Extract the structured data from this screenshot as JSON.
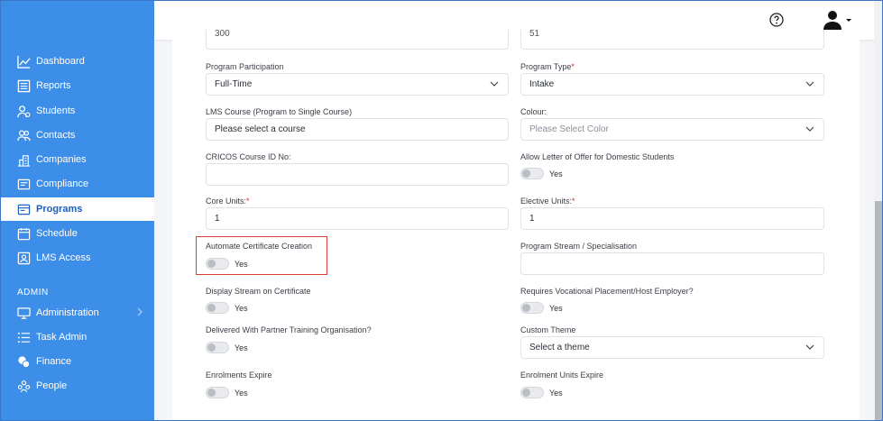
{
  "sidebar": {
    "items": [
      {
        "label": "Dashboard",
        "icon": "chart-line-icon"
      },
      {
        "label": "Reports",
        "icon": "report-icon"
      },
      {
        "label": "Students",
        "icon": "students-icon"
      },
      {
        "label": "Contacts",
        "icon": "contacts-icon"
      },
      {
        "label": "Companies",
        "icon": "companies-icon"
      },
      {
        "label": "Compliance",
        "icon": "compliance-icon"
      },
      {
        "label": "Programs",
        "icon": "programs-icon",
        "active": true
      },
      {
        "label": "Schedule",
        "icon": "calendar-icon"
      },
      {
        "label": "LMS Access",
        "icon": "lms-icon"
      }
    ],
    "admin_section": "ADMIN",
    "admin_items": [
      {
        "label": "Administration",
        "icon": "monitor-icon",
        "has_children": true
      },
      {
        "label": "Task Admin",
        "icon": "list-icon"
      },
      {
        "label": "Finance",
        "icon": "coins-icon"
      },
      {
        "label": "People",
        "icon": "people-icon"
      }
    ]
  },
  "header": {
    "help_icon": "help-circle-icon",
    "user_icon": "user-avatar-icon"
  },
  "form": {
    "top_left_partial": "300",
    "top_right_partial": "51",
    "program_participation": {
      "label": "Program Participation",
      "value": "Full-Time"
    },
    "program_type": {
      "label": "Program Type",
      "required": "*",
      "value": "Intake"
    },
    "lms_course": {
      "label": "LMS Course (Program to Single Course)",
      "value": "Please select a course"
    },
    "colour": {
      "label": "Colour:",
      "placeholder": "Please Select Color"
    },
    "cricos": {
      "label": "CRICOS Course ID No:",
      "value": ""
    },
    "allow_letter": {
      "label": "Allow Letter of Offer for Domestic Students",
      "toggle_label": "Yes"
    },
    "core_units": {
      "label": "Core Units:",
      "required": "*",
      "value": "1"
    },
    "elective_units": {
      "label": "Elective Units:",
      "required": "*",
      "value": "1"
    },
    "automate_certificate": {
      "label": "Automate Certificate Creation",
      "toggle_label": "Yes"
    },
    "program_stream": {
      "label": "Program Stream / Specialisation",
      "value": ""
    },
    "display_stream": {
      "label": "Display Stream on Certificate",
      "toggle_label": "Yes"
    },
    "vocational_placement": {
      "label": "Requires Vocational Placement/Host Employer?",
      "toggle_label": "Yes"
    },
    "partner_org": {
      "label": "Delivered With Partner Training Organisation?",
      "toggle_label": "Yes"
    },
    "custom_theme": {
      "label": "Custom Theme",
      "value": "Select a theme"
    },
    "enrolments_expire": {
      "label": "Enrolments Expire",
      "toggle_label": "Yes"
    },
    "enrolment_units_expire": {
      "label": "Enrolment Units Expire",
      "toggle_label": "Yes"
    }
  },
  "colors": {
    "sidebar": "#3d8ee8",
    "highlight": "#d9403a",
    "required": "#d9262c"
  }
}
